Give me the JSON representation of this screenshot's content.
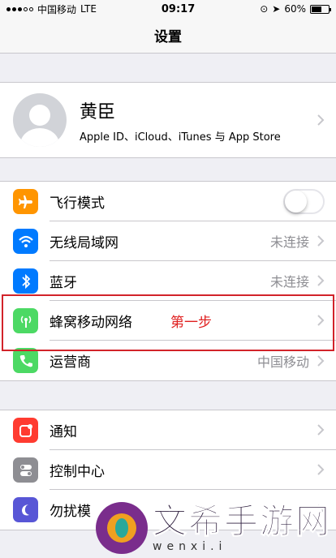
{
  "status_bar": {
    "carrier": "中国移动",
    "network": "LTE",
    "time": "09:17",
    "battery": "60%",
    "battery_level": 0.6
  },
  "nav": {
    "title": "设置"
  },
  "profile": {
    "name": "黄臣",
    "subtitle": "Apple ID、iCloud、iTunes 与 App Store"
  },
  "group1": [
    {
      "label": "飞行模式",
      "icon": "airplane-icon",
      "color": "#ff9500",
      "toggle_on": false
    },
    {
      "label": "无线局域网",
      "icon": "wifi-icon",
      "color": "#007aff",
      "value": "未连接"
    },
    {
      "label": "蓝牙",
      "icon": "bluetooth-icon",
      "color": "#007aff",
      "value": "未连接"
    },
    {
      "label": "蜂窝移动网络",
      "icon": "cellular-icon",
      "color": "#4cd964"
    },
    {
      "label": "运营商",
      "icon": "phone-icon",
      "color": "#4cd964",
      "value": "中国移动"
    }
  ],
  "group2": [
    {
      "label": "通知",
      "icon": "notifications-icon",
      "color": "#ff3b30"
    },
    {
      "label": "控制中心",
      "icon": "control-center-icon",
      "color": "#8e8e93"
    },
    {
      "label": "勿扰模",
      "icon": "moon-icon",
      "color": "#5856d6"
    }
  ],
  "annotation": {
    "text": "第一步",
    "color": "#e02020"
  },
  "watermark": {
    "title": "文希手游网",
    "url": "wenxi.i"
  }
}
